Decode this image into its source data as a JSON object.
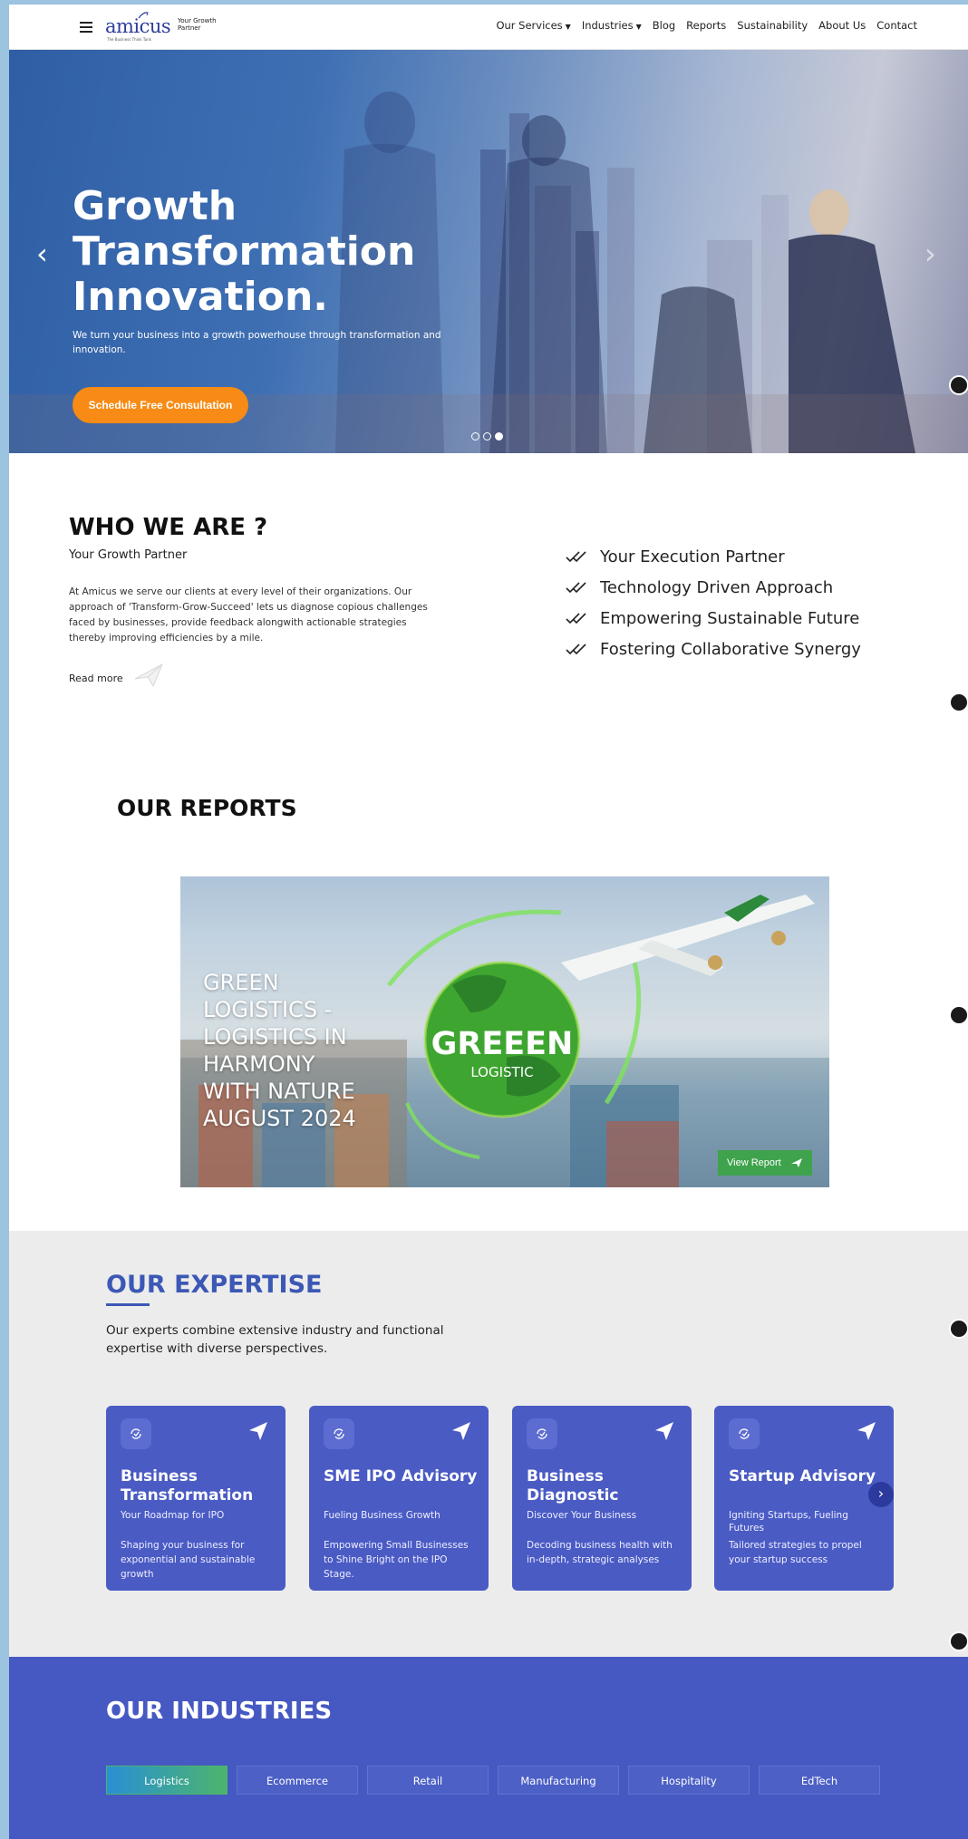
{
  "header": {
    "logo_text": "amicus",
    "logo_subtext": "The Business Think Tank",
    "tagline": "Your Growth Partner",
    "nav": [
      {
        "label": "Our Services",
        "dropdown": true
      },
      {
        "label": "Industries",
        "dropdown": true
      },
      {
        "label": "Blog",
        "dropdown": false
      },
      {
        "label": "Reports",
        "dropdown": false
      },
      {
        "label": "Sustainability",
        "dropdown": false
      },
      {
        "label": "About Us",
        "dropdown": false
      },
      {
        "label": "Contact",
        "dropdown": false
      }
    ]
  },
  "hero": {
    "title_lines": [
      "Growth",
      "Transformation",
      "Innovation."
    ],
    "subtitle": "We turn your business into a growth powerhouse through transformation and innovation.",
    "cta": "Schedule Free Consultation",
    "prev_icon": "‹",
    "next_icon": "›",
    "slides": 3,
    "active_slide": 3
  },
  "who": {
    "heading": "WHO WE ARE ?",
    "subheading": "Your Growth Partner",
    "body": "At Amicus we serve our clients at every level of their organizations. Our approach of 'Transform-Grow-Succeed' lets us diagnose copious challenges faced by businesses, provide feedback alongwith actionable strategies thereby improving efficiencies by a mile.",
    "read_more": "Read more",
    "points": [
      "Your Execution Partner",
      "Technology Driven Approach",
      "Empowering Sustainable Future",
      "Fostering Collaborative Synergy"
    ]
  },
  "reports": {
    "heading": "OUR REPORTS",
    "card_title": "GREEN LOGISTICS - LOGISTICS IN HARMONY WITH NATURE AUGUST 2024",
    "globe_title": "GREEEN",
    "globe_subtitle": "LOGISTIC",
    "view_button": "View Report"
  },
  "expertise": {
    "heading": "OUR EXPERTISE",
    "description": "Our experts combine extensive industry and functional expertise with diverse perspectives.",
    "cards": [
      {
        "title": "Business Transformation",
        "tagline": "Your Roadmap for IPO",
        "text": "Shaping your business for exponential and sustainable growth"
      },
      {
        "title": "SME IPO Advisory",
        "tagline": "Fueling Business Growth",
        "text": "Empowering Small Businesses to Shine Bright on the IPO Stage."
      },
      {
        "title": "Business Diagnostic",
        "tagline": "Discover Your Business",
        "text": "Decoding business health with in-depth, strategic analyses"
      },
      {
        "title": "Startup Advisory",
        "tagline": "Igniting Startups, Fueling Futures",
        "text": "Tailored strategies to propel your startup success"
      }
    ],
    "next_icon": "›"
  },
  "industries": {
    "heading": "OUR INDUSTRIES",
    "tabs": [
      "Logistics",
      "Ecommerce",
      "Retail",
      "Manufacturing",
      "Hospitality",
      "EdTech"
    ],
    "active_tab": "Logistics"
  },
  "colors": {
    "brand_blue": "#3c58b5",
    "card_blue": "#4a5bc4",
    "cta_orange": "#f78b15",
    "report_green": "#3fa34d",
    "industries_bg": "#4659c2"
  }
}
